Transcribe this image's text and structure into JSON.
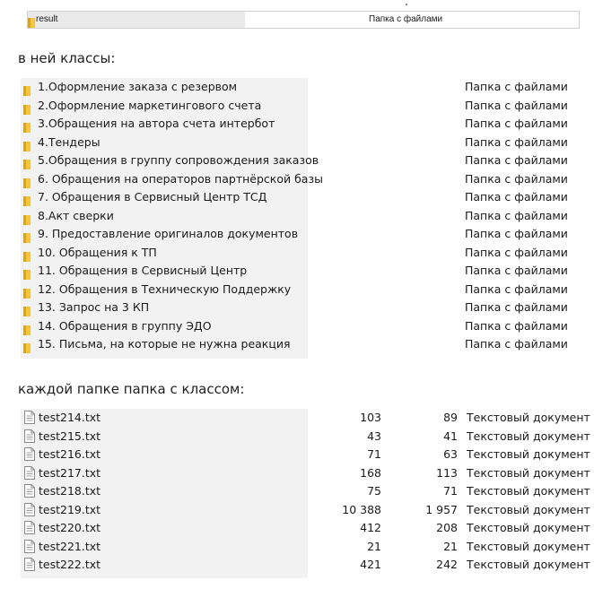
{
  "top_row": {
    "name": "result",
    "type": "Папка с файлами"
  },
  "captions": {
    "classes": "в ней классы:",
    "each_folder": "каждой папке папка с классом:"
  },
  "folders": [
    {
      "name": "1.Оформление заказа с резервом",
      "type": "Папка с файлами"
    },
    {
      "name": "2.Оформление маркетингового счета",
      "type": "Папка с файлами"
    },
    {
      "name": "3.Обращения на автора счета интербот",
      "type": "Папка с файлами"
    },
    {
      "name": "4.Тендеры",
      "type": "Папка с файлами"
    },
    {
      "name": "5.Обращения в группу сопровождения заказов",
      "type": "Папка с файлами"
    },
    {
      "name": "6. Обращения на операторов партнёрской базы",
      "type": "Папка с файлами"
    },
    {
      "name": "7. Обращения в Сервисный Центр ТСД",
      "type": "Папка с файлами"
    },
    {
      "name": "8.Акт сверки",
      "type": "Папка с файлами"
    },
    {
      "name": "9. Предоставление оригиналов документов",
      "type": "Папка с файлами"
    },
    {
      "name": "10. Обращения к ТП",
      "type": "Папка с файлами"
    },
    {
      "name": "11. Обращения в Сервисный Центр",
      "type": "Папка с файлами"
    },
    {
      "name": "12. Обращения в Техническую Поддержку",
      "type": "Папка с файлами"
    },
    {
      "name": "13. Запрос на 3 КП",
      "type": "Папка с файлами"
    },
    {
      "name": "14. Обращения в группу ЭДО",
      "type": "Папка с файлами"
    },
    {
      "name": "15. Письма, на которые не нужна реакция",
      "type": "Папка с файлами"
    }
  ],
  "files": [
    {
      "name": "test214.txt",
      "size1": "103",
      "size2": "89",
      "type": "Текстовый документ"
    },
    {
      "name": "test215.txt",
      "size1": "43",
      "size2": "41",
      "type": "Текстовый документ"
    },
    {
      "name": "test216.txt",
      "size1": "71",
      "size2": "63",
      "type": "Текстовый документ"
    },
    {
      "name": "test217.txt",
      "size1": "168",
      "size2": "113",
      "type": "Текстовый документ"
    },
    {
      "name": "test218.txt",
      "size1": "75",
      "size2": "71",
      "type": "Текстовый документ"
    },
    {
      "name": "test219.txt",
      "size1": "10 388",
      "size2": "1 957",
      "type": "Текстовый документ"
    },
    {
      "name": "test220.txt",
      "size1": "412",
      "size2": "208",
      "type": "Текстовый документ"
    },
    {
      "name": "test221.txt",
      "size1": "21",
      "size2": "21",
      "type": "Текстовый документ"
    },
    {
      "name": "test222.txt",
      "size1": "421",
      "size2": "242",
      "type": "Текстовый документ"
    }
  ],
  "icons": {
    "folder": "folder-icon",
    "file": "text-file-icon"
  },
  "colors": {
    "folder_yellow": "#f4c542",
    "folder_dark": "#d9a520",
    "selection_bg": "#e9e9e9"
  }
}
